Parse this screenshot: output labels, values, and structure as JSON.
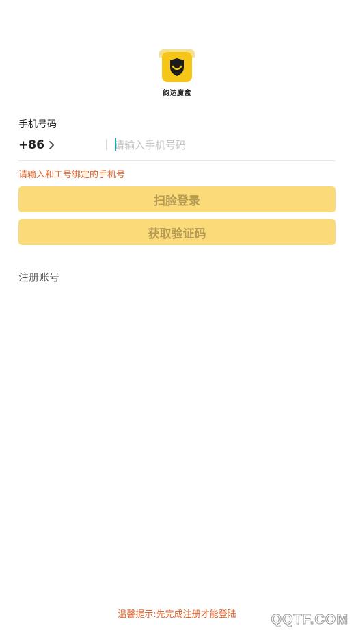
{
  "logo": {
    "icon": "smiling-shield-icon",
    "text": "韵达魔盒",
    "brand_color": "#f5c518"
  },
  "login": {
    "phone_label": "手机号码",
    "country_code": "+86",
    "phone_placeholder": "请输入手机号码",
    "phone_value": "",
    "bind_hint": "请输入和工号绑定的手机号",
    "face_login_label": "扫脸登录",
    "get_code_label": "获取验证码",
    "register_label": "注册账号"
  },
  "footer": {
    "tip": "温馨提示:先完成注册才能登陆",
    "watermark": "QQTF.COM"
  },
  "colors": {
    "button_bg": "#fbdb79",
    "button_text": "#b49a52",
    "hint": "#e0652b",
    "caret": "#1aa7a7"
  }
}
